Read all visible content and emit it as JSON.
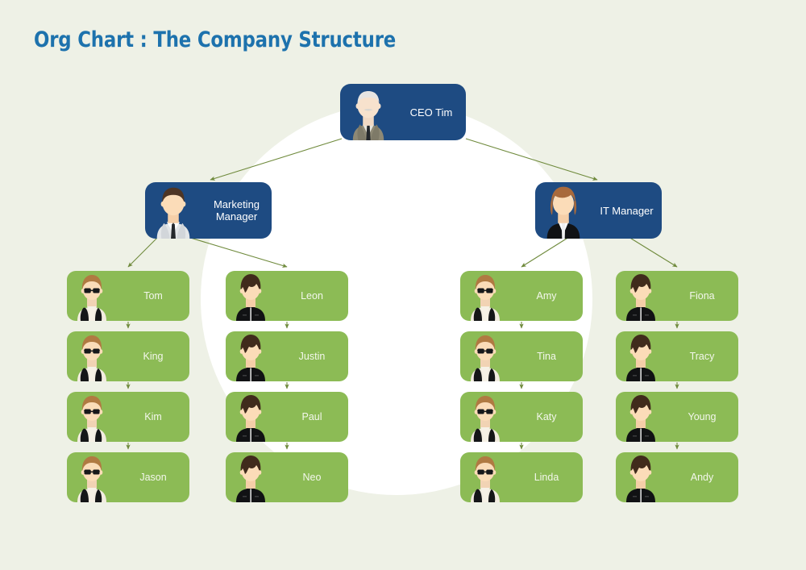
{
  "page": {
    "title": "Org Chart : The Company Structure",
    "background_color": "#eef1e6",
    "circle_color": "#ffffff",
    "title_color": "#1d72ad"
  },
  "palette": {
    "manager_node": "#1e4b82",
    "staff_node": "#8cbb55",
    "connector": "#6f8a3c",
    "node_text": "#ffffff"
  },
  "chart_data": {
    "type": "diagram",
    "diagram_type": "org-chart",
    "title": "Org Chart : The Company Structure",
    "nodes": [
      {
        "id": "ceo",
        "label": "CEO Tim",
        "level": 0,
        "style": "blue",
        "avatar": "senior-man-suit-avatar"
      },
      {
        "id": "marketing",
        "label": "Marketing Manager",
        "level": 1,
        "style": "blue",
        "avatar": "man-shirt-tie-avatar"
      },
      {
        "id": "it",
        "label": "IT Manager",
        "level": 1,
        "style": "blue",
        "avatar": "woman-black-jacket-avatar"
      },
      {
        "id": "tom",
        "label": "Tom",
        "level": 2,
        "style": "green",
        "avatar": "person-glasses-vest-avatar"
      },
      {
        "id": "king",
        "label": "King",
        "level": 3,
        "style": "green",
        "avatar": "person-glasses-vest-avatar"
      },
      {
        "id": "kim",
        "label": "Kim",
        "level": 4,
        "style": "green",
        "avatar": "person-glasses-vest-avatar"
      },
      {
        "id": "jason",
        "label": "Jason",
        "level": 5,
        "style": "green",
        "avatar": "person-glasses-vest-avatar"
      },
      {
        "id": "leon",
        "label": "Leon",
        "level": 2,
        "style": "green",
        "avatar": "person-spiky-hair-jacket-avatar"
      },
      {
        "id": "justin",
        "label": "Justin",
        "level": 3,
        "style": "green",
        "avatar": "person-spiky-hair-jacket-avatar"
      },
      {
        "id": "paul",
        "label": "Paul",
        "level": 4,
        "style": "green",
        "avatar": "person-spiky-hair-jacket-avatar"
      },
      {
        "id": "neo",
        "label": "Neo",
        "level": 5,
        "style": "green",
        "avatar": "person-spiky-hair-jacket-avatar"
      },
      {
        "id": "amy",
        "label": "Amy",
        "level": 2,
        "style": "green",
        "avatar": "person-glasses-vest-avatar"
      },
      {
        "id": "tina",
        "label": "Tina",
        "level": 3,
        "style": "green",
        "avatar": "person-glasses-vest-avatar"
      },
      {
        "id": "katy",
        "label": "Katy",
        "level": 4,
        "style": "green",
        "avatar": "person-glasses-vest-avatar"
      },
      {
        "id": "linda",
        "label": "Linda",
        "level": 5,
        "style": "green",
        "avatar": "person-glasses-vest-avatar"
      },
      {
        "id": "fiona",
        "label": "Fiona",
        "level": 2,
        "style": "green",
        "avatar": "person-spiky-hair-jacket-avatar"
      },
      {
        "id": "tracy",
        "label": "Tracy",
        "level": 3,
        "style": "green",
        "avatar": "person-spiky-hair-jacket-avatar"
      },
      {
        "id": "young",
        "label": "Young",
        "level": 4,
        "style": "green",
        "avatar": "person-spiky-hair-jacket-avatar"
      },
      {
        "id": "andy",
        "label": "Andy",
        "level": 5,
        "style": "green",
        "avatar": "person-spiky-hair-jacket-avatar"
      }
    ],
    "edges": [
      {
        "from": "ceo",
        "to": "marketing"
      },
      {
        "from": "ceo",
        "to": "it"
      },
      {
        "from": "marketing",
        "to": "tom"
      },
      {
        "from": "marketing",
        "to": "leon"
      },
      {
        "from": "it",
        "to": "amy"
      },
      {
        "from": "it",
        "to": "fiona"
      },
      {
        "from": "tom",
        "to": "king"
      },
      {
        "from": "king",
        "to": "kim"
      },
      {
        "from": "kim",
        "to": "jason"
      },
      {
        "from": "leon",
        "to": "justin"
      },
      {
        "from": "justin",
        "to": "paul"
      },
      {
        "from": "paul",
        "to": "neo"
      },
      {
        "from": "amy",
        "to": "tina"
      },
      {
        "from": "tina",
        "to": "katy"
      },
      {
        "from": "katy",
        "to": "linda"
      },
      {
        "from": "fiona",
        "to": "tracy"
      },
      {
        "from": "tracy",
        "to": "young"
      },
      {
        "from": "young",
        "to": "andy"
      }
    ],
    "columns": [
      {
        "manager": "Marketing Manager",
        "members": [
          "Tom",
          "King",
          "Kim",
          "Jason"
        ]
      },
      {
        "manager": "Marketing Manager",
        "members": [
          "Leon",
          "Justin",
          "Paul",
          "Neo"
        ]
      },
      {
        "manager": "IT Manager",
        "members": [
          "Amy",
          "Tina",
          "Katy",
          "Linda"
        ]
      },
      {
        "manager": "IT Manager",
        "members": [
          "Fiona",
          "Tracy",
          "Young",
          "Andy"
        ]
      }
    ]
  },
  "nodes": {
    "ceo": {
      "label": "CEO Tim"
    },
    "marketing": {
      "line1": "Marketing",
      "line2": "Manager"
    },
    "it": {
      "label": "IT Manager"
    },
    "tom": {
      "label": "Tom"
    },
    "king": {
      "label": "King"
    },
    "kim": {
      "label": "Kim"
    },
    "jason": {
      "label": "Jason"
    },
    "leon": {
      "label": "Leon"
    },
    "justin": {
      "label": "Justin"
    },
    "paul": {
      "label": "Paul"
    },
    "neo": {
      "label": "Neo"
    },
    "amy": {
      "label": "Amy"
    },
    "tina": {
      "label": "Tina"
    },
    "katy": {
      "label": "Katy"
    },
    "linda": {
      "label": "Linda"
    },
    "fiona": {
      "label": "Fiona"
    },
    "tracy": {
      "label": "Tracy"
    },
    "young": {
      "label": "Young"
    },
    "andy": {
      "label": "Andy"
    }
  }
}
